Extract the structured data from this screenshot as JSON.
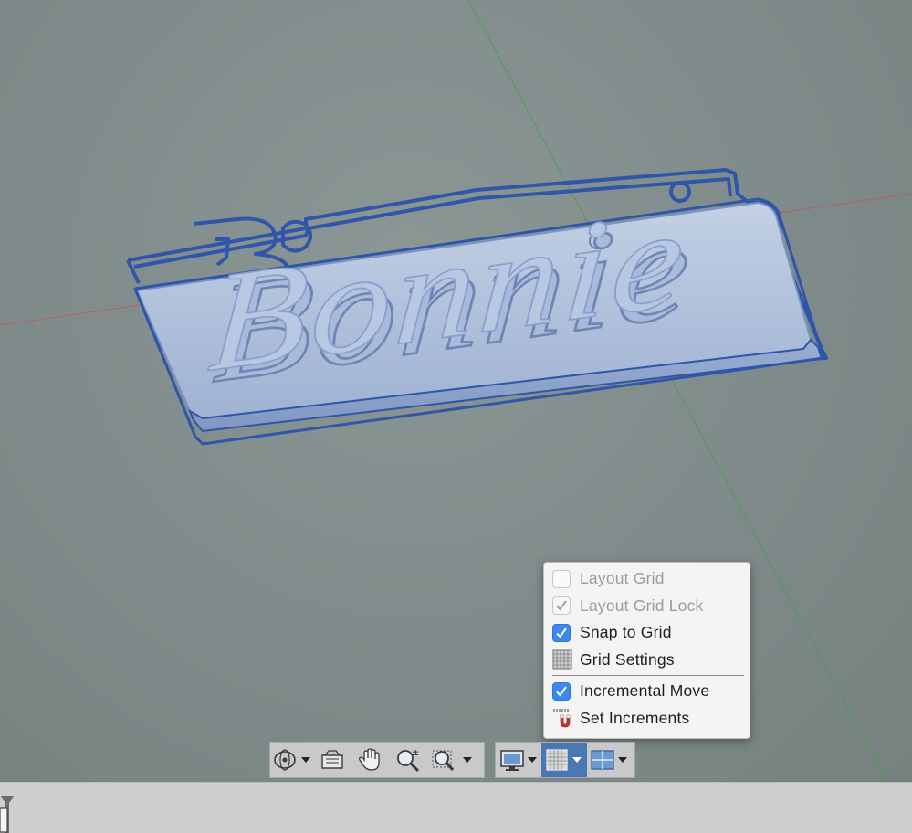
{
  "model": {
    "text": "Bonnie"
  },
  "grid_menu": {
    "items": [
      {
        "label": "Layout Grid",
        "state": "unchecked",
        "enabled": false
      },
      {
        "label": "Layout Grid Lock",
        "state": "checked",
        "enabled": false
      },
      {
        "label": "Snap to Grid",
        "state": "checked",
        "enabled": true
      },
      {
        "label": "Grid Settings",
        "icon": "grid-settings-icon",
        "enabled": true
      },
      {
        "label": "Incremental Move",
        "state": "checked",
        "enabled": true
      },
      {
        "label": "Set Increments",
        "icon": "magnet-icon",
        "enabled": true
      }
    ]
  },
  "toolbar": {
    "buttons": [
      {
        "icon": "orbit-icon",
        "has_dropdown": true
      },
      {
        "icon": "look-at-icon"
      },
      {
        "icon": "pan-hand-icon"
      },
      {
        "icon": "zoom-icon"
      },
      {
        "icon": "fit-window-icon",
        "has_dropdown": true
      },
      {
        "icon": "display-settings-icon",
        "has_dropdown": true
      },
      {
        "icon": "grid-snaps-icon",
        "has_dropdown": true,
        "active": true
      },
      {
        "icon": "viewports-icon",
        "has_dropdown": true
      }
    ]
  },
  "colors": {
    "accent": "#3a88f0",
    "selection_blue": "#2f56a8",
    "active_toolbar": "#4a78b5",
    "x_axis": "#c85050",
    "y_axis": "#3fa040"
  }
}
